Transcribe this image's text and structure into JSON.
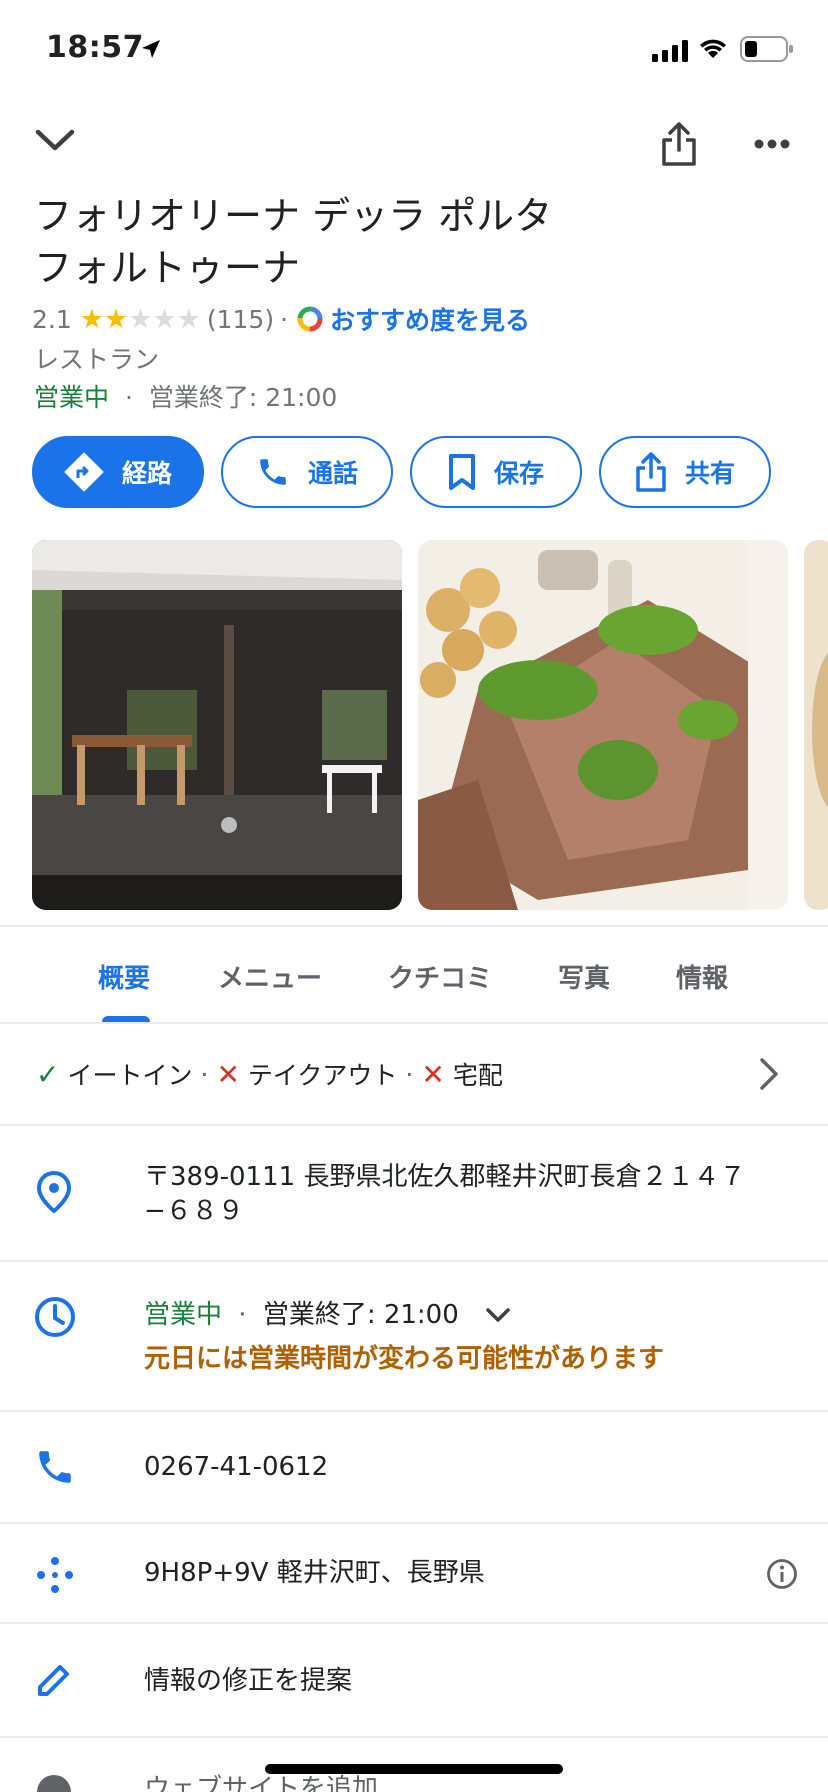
{
  "status_bar": {
    "time": "18:57"
  },
  "place": {
    "name_line1": "フォリオリーナ デッラ ポルタ",
    "name_line2": "フォルトゥーナ",
    "rating": "2.1",
    "stars_filled": 2,
    "stars_total": 5,
    "review_count": "(115)",
    "separator": "·",
    "recommend_label": "おすすめ度を見る",
    "category": "レストラン",
    "open_status": "営業中",
    "close_time": "営業終了: 21:00"
  },
  "actions": [
    {
      "label": "経路",
      "icon": "directions-icon"
    },
    {
      "label": "通話",
      "icon": "phone-icon"
    },
    {
      "label": "保存",
      "icon": "bookmark-icon"
    },
    {
      "label": "共有",
      "icon": "share-icon"
    }
  ],
  "tabs": [
    {
      "label": "概要",
      "active": true
    },
    {
      "label": "メニュー",
      "active": false
    },
    {
      "label": "クチコミ",
      "active": false
    },
    {
      "label": "写真",
      "active": false
    },
    {
      "label": "情報",
      "active": false
    }
  ],
  "services": [
    {
      "label": "イートイン",
      "available": true
    },
    {
      "label": "テイクアウト",
      "available": false
    },
    {
      "label": "宅配",
      "available": false
    }
  ],
  "info": {
    "address_line1": "〒389-0111 長野県北佐久郡軽井沢町長倉２１４７",
    "address_line2": "−６８９",
    "hours_open": "営業中",
    "hours_close": "営業終了: 21:00",
    "hours_warning": "元日には営業時間が変わる可能性があります",
    "phone": "0267-41-0612",
    "plus_code": "9H8P+9V 軽井沢町、長野県",
    "suggest_edit": "情報の修正を提案",
    "website": "ウェブサイトを追加"
  },
  "colors": {
    "accent": "#1a73e8",
    "open_green": "#188038",
    "warning": "#b06000",
    "star": "#fbbc04",
    "unavailable": "#d93025"
  }
}
